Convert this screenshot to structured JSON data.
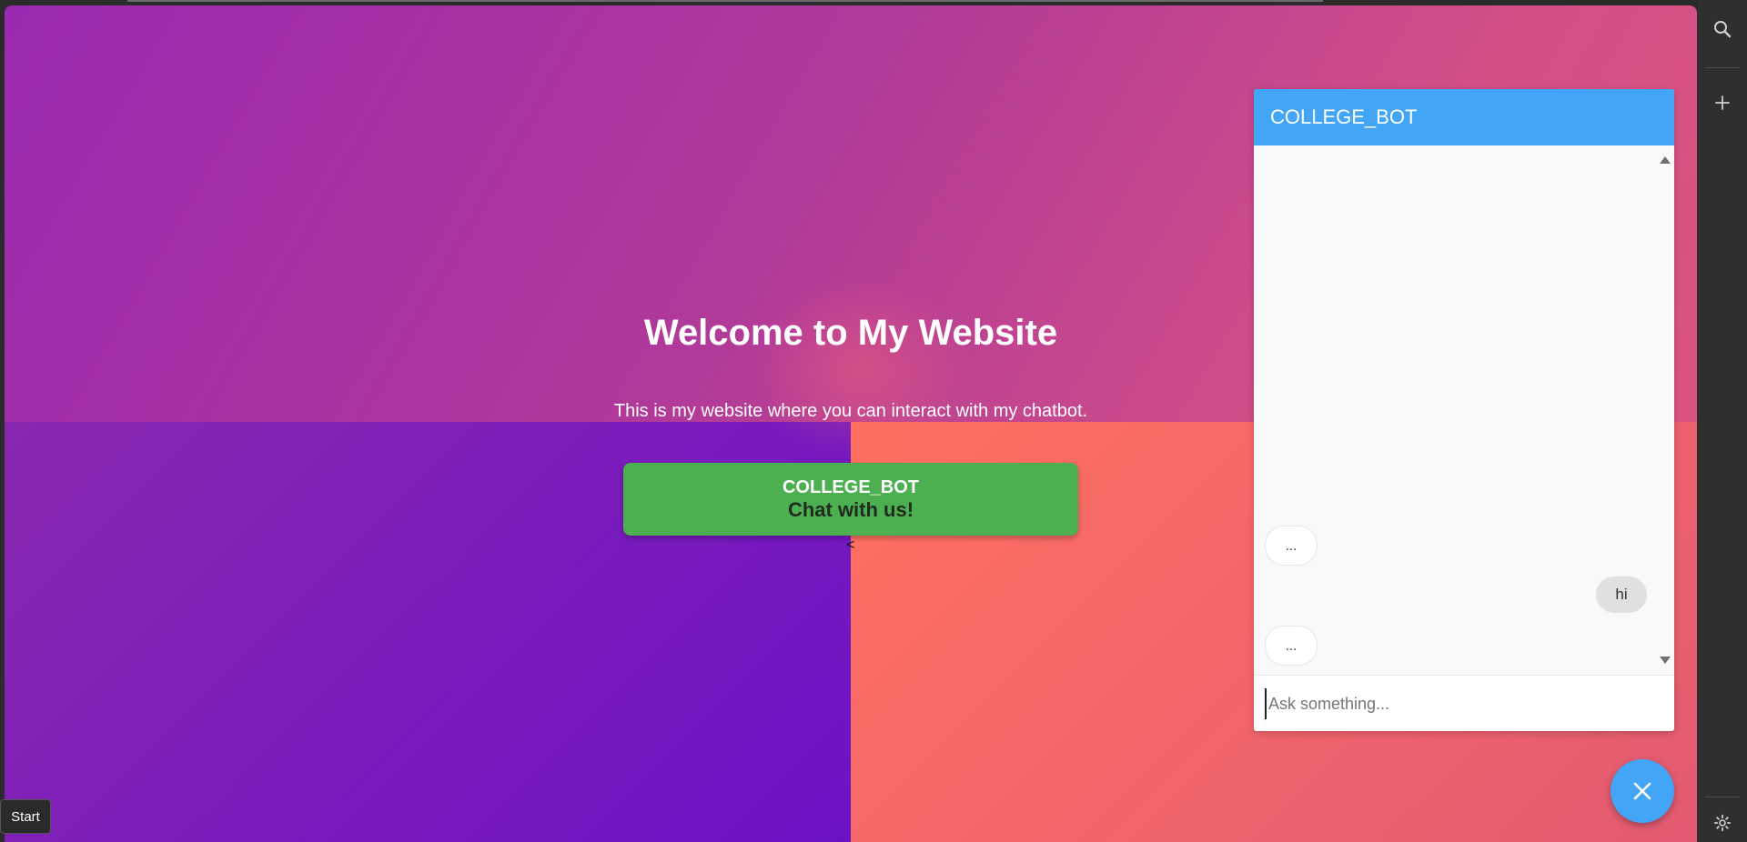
{
  "page": {
    "title": "Welcome to My Website",
    "subtitle": "This is my website where you can interact with my chatbot.",
    "cta": {
      "line1": "COLLEGE_BOT",
      "line2": "Chat with us!"
    },
    "stray_text": "<"
  },
  "chat": {
    "header": "COLLEGE_BOT",
    "messages": [
      {
        "from": "bot",
        "text": "..."
      },
      {
        "from": "user",
        "text": "hi"
      },
      {
        "from": "bot",
        "text": "..."
      }
    ],
    "input": {
      "placeholder": "Ask something...",
      "value": ""
    },
    "fab_icon": "close-icon"
  },
  "browser": {
    "sidebar_icons": [
      "search-icon",
      "plus-icon",
      "gear-icon"
    ],
    "start_tooltip": "Start"
  },
  "colors": {
    "chat_accent": "#42a5f5",
    "cta_green": "#4caf50",
    "bg_purple": "#9a2ab0",
    "bg_coral": "#ff7060"
  }
}
